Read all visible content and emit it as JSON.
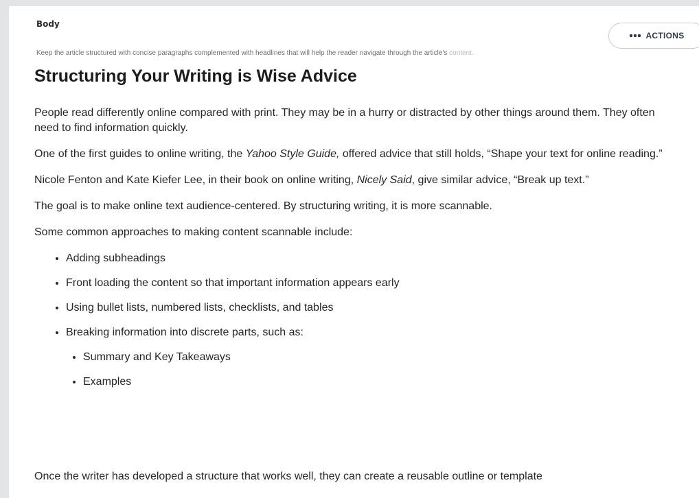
{
  "field": {
    "label": "Body",
    "help_text": "Keep the article structured with concise paragraphs complemented with headlines that will help the reader navigate through the article's",
    "help_text_fade": " content."
  },
  "actions": {
    "label": "ACTIONS",
    "icon": "more-dots-icon"
  },
  "article": {
    "title": "Structuring Your Writing is Wise Advice",
    "p1": "People read differently online compared with print. They may be in a hurry or distracted by other things around them. They often need to find information quickly.",
    "p2": {
      "before": "One of the first guides to online writing, the ",
      "italic": "Yahoo Style Guide,",
      "after": " offered advice that still holds, “Shape your text for online reading.”"
    },
    "p3": {
      "before": "Nicole Fenton and Kate Kiefer Lee, in their book on online writing, ",
      "italic": "Nicely Said",
      "after": ", give similar advice, “Break up text.”"
    },
    "p4": "The goal is to make online text audience-centered. By structuring writing, it is more scannable.",
    "p5": "Some common approaches to making content scannable include:",
    "bullets": [
      "Adding subheadings",
      "Front loading the content so that important information appears early",
      "Using bullet lists, numbered lists, checklists, and tables",
      "Breaking information into discrete parts, such as:"
    ],
    "sub_bullets": [
      "Summary and Key Takeaways",
      "Examples"
    ],
    "p6_partial": "Once the writer has developed a structure that works well, they can create a reusable outline or template"
  }
}
